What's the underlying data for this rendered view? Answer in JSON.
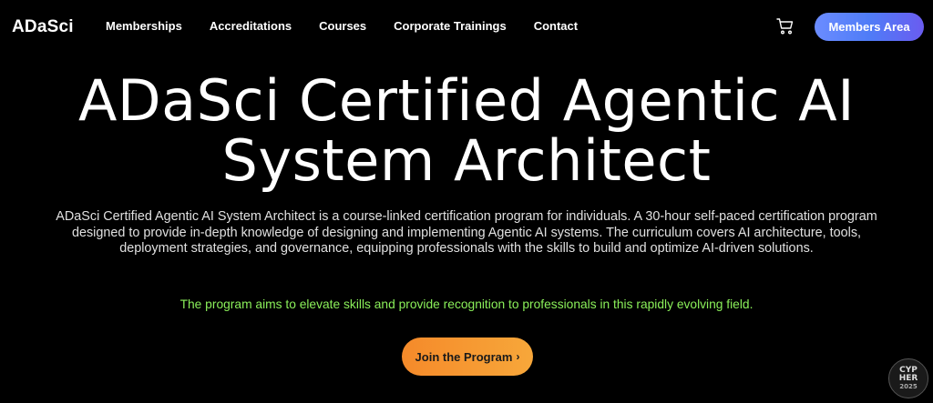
{
  "nav": {
    "logo": "ADaSci",
    "links": [
      "Memberships",
      "Accreditations",
      "Courses",
      "Corporate Trainings",
      "Contact"
    ],
    "cart_icon": "cart-icon",
    "members_label": "Members Area"
  },
  "hero": {
    "title_line1": "ADaSci Certified Agentic AI",
    "title_line2": "System Architect",
    "description": "ADaSci Certified Agentic AI System Architect is a course-linked certification program for individuals. A 30-hour self-paced certification program designed to provide in-depth knowledge of designing and implementing Agentic AI systems. The curriculum covers AI architecture, tools, deployment strategies, and governance, equipping professionals with the skills to build and optimize AI-driven solutions.",
    "aim": "The program aims to elevate skills and provide recognition to professionals in this rapidly evolving field.",
    "cta_label": "Join the Program",
    "cta_chevron": "›"
  },
  "badge": {
    "line1": "CYP",
    "line2": "HER",
    "line3": "2025"
  },
  "colors": {
    "background": "#000000",
    "members_gradient_start": "#6b8cff",
    "members_gradient_end": "#6a5cf0",
    "aim_text": "#8bf05a",
    "cta_gradient_start": "#f58a2a",
    "cta_gradient_end": "#f7a73a"
  }
}
